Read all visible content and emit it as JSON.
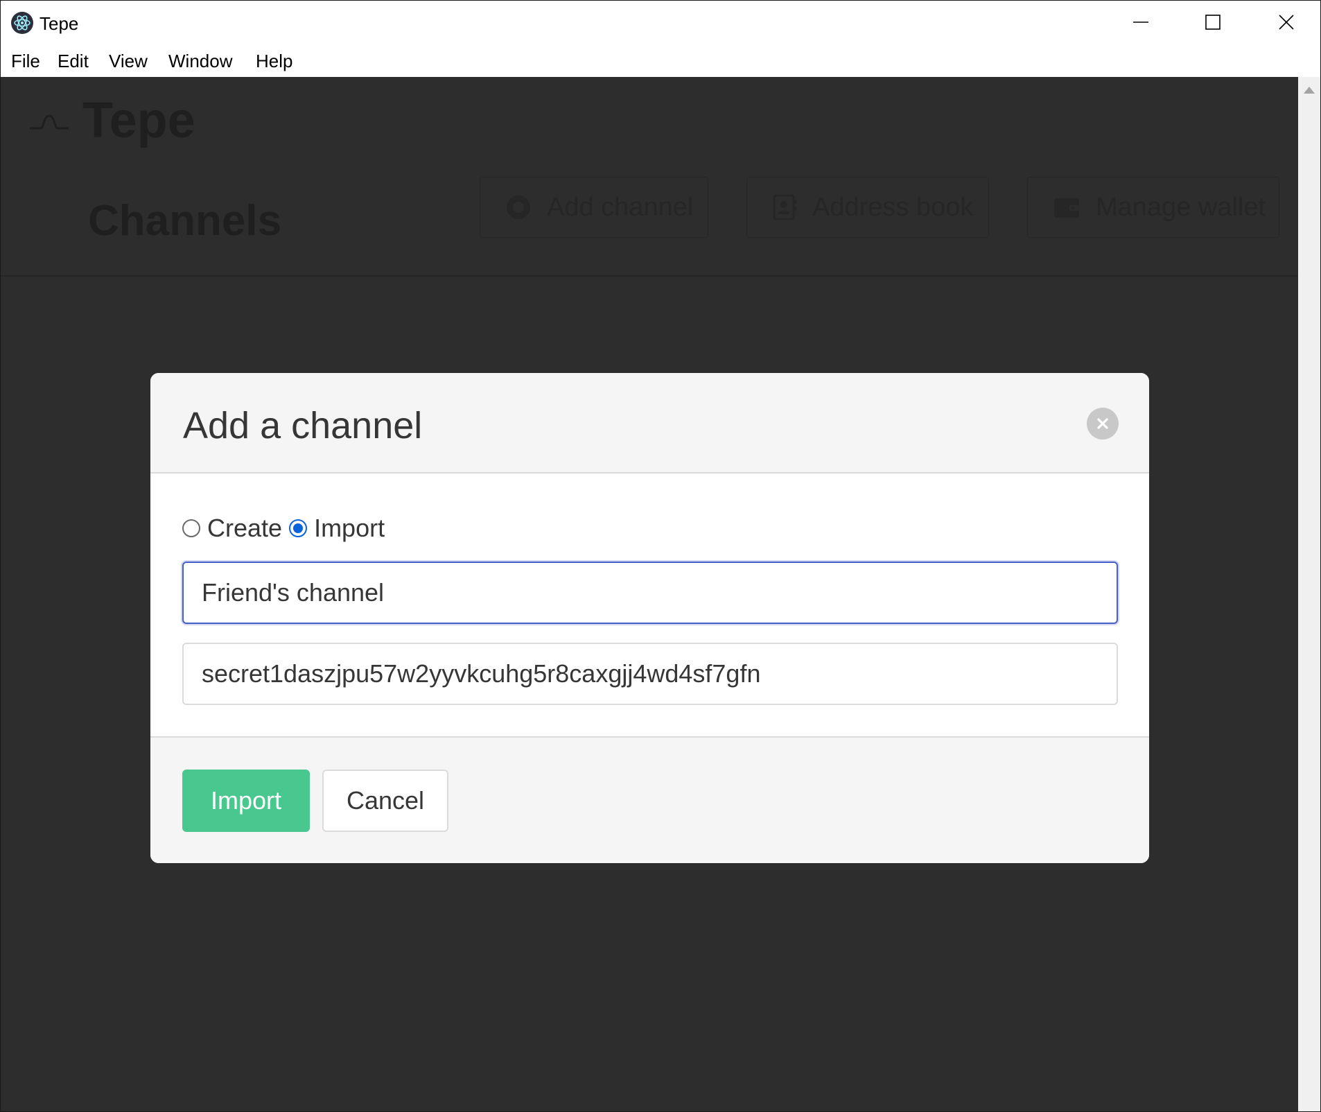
{
  "window": {
    "title": "Tepe",
    "controls": {
      "minimize": "minimize-icon",
      "maximize": "maximize-icon",
      "close": "close-icon"
    }
  },
  "menu": {
    "items": [
      "File",
      "Edit",
      "View",
      "Window",
      "Help"
    ]
  },
  "app": {
    "brand": "Tepe",
    "page_title": "Channels",
    "actions": [
      {
        "label": "Add channel",
        "icon": "plus-circle-icon"
      },
      {
        "label": "Address book",
        "icon": "address-book-icon"
      },
      {
        "label": "Manage wallet",
        "icon": "wallet-icon"
      }
    ]
  },
  "modal": {
    "title": "Add a channel",
    "mode_options": [
      {
        "label": "Create",
        "checked": false
      },
      {
        "label": "Import",
        "checked": true
      }
    ],
    "name_input": {
      "value": "Friend's channel"
    },
    "secret_input": {
      "value": "secret1daszjpu57w2yyvkcuhg5r8caxgjj4wd4sf7gfn"
    },
    "submit_label": "Import",
    "cancel_label": "Cancel"
  },
  "colors": {
    "overlay": "#2d2d2d",
    "primary": "#48c78e",
    "focus": "#485fc7",
    "radio_accent": "#0a63d8"
  }
}
